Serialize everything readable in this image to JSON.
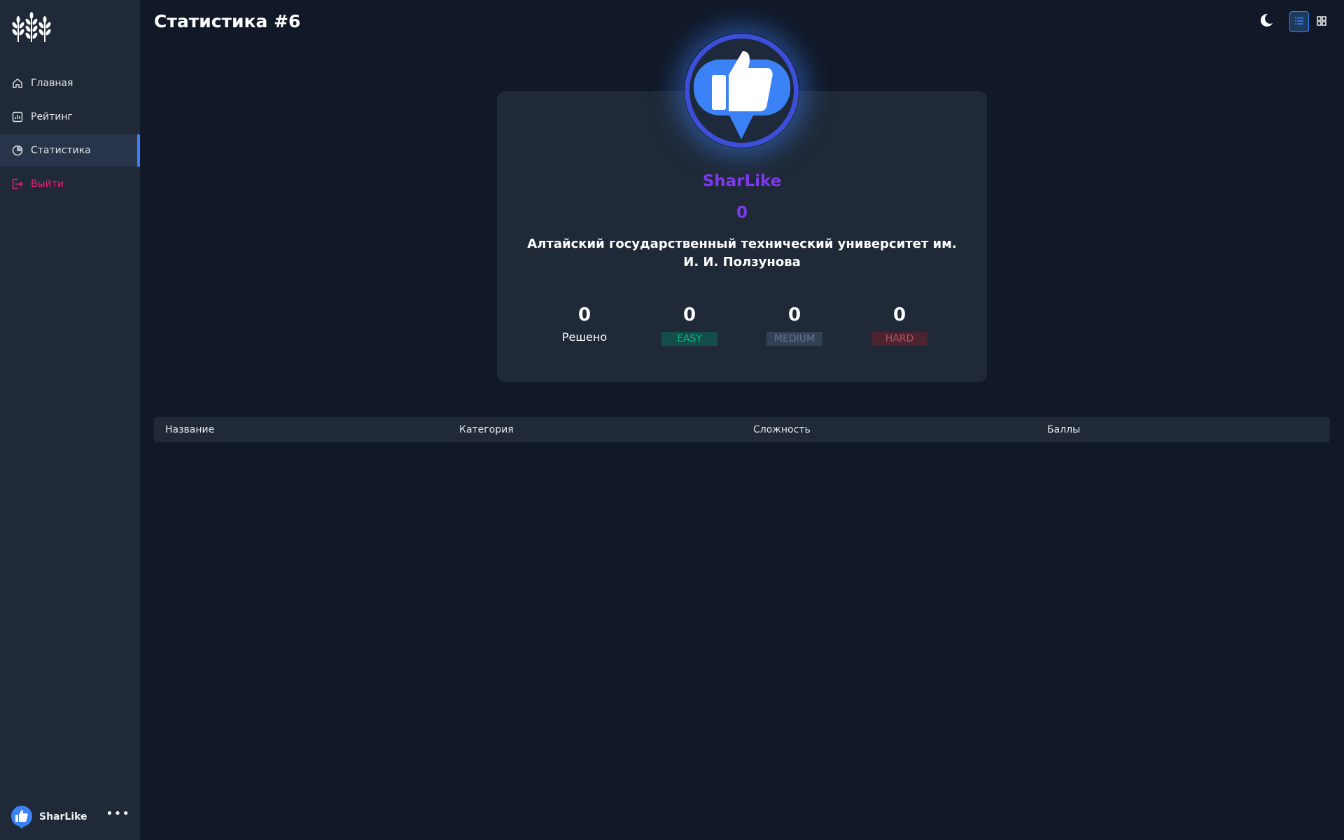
{
  "sidebar": {
    "items": [
      {
        "label": "Главная",
        "icon": "home-icon"
      },
      {
        "label": "Рейтинг",
        "icon": "chart-icon"
      },
      {
        "label": "Статистика",
        "icon": "pie-chart-icon",
        "active": true
      },
      {
        "label": "Выйти",
        "icon": "logout-icon"
      }
    ],
    "user": {
      "name": "SharLike",
      "menu": "•••"
    }
  },
  "header": {
    "title": "Статистика #6"
  },
  "profile": {
    "name": "SharLike",
    "score": "0",
    "university": "Алтайский государственный технический университет им. И. И. Ползунова",
    "stats": [
      {
        "value": "0",
        "label": "Решено"
      },
      {
        "value": "0",
        "label": "EASY"
      },
      {
        "value": "0",
        "label": "MEDIUM"
      },
      {
        "value": "0",
        "label": "HARD"
      }
    ]
  },
  "table": {
    "columns": [
      "Название",
      "Категория",
      "Сложность",
      "Баллы"
    ]
  },
  "colors": {
    "background": "#111827",
    "sidebar": "#1f2937",
    "accent": "#3b82f6",
    "brand": "#7c3aed",
    "logout": "#db2777",
    "easy": "#10b981",
    "medium": "#64748b",
    "hard": "#b45360"
  }
}
